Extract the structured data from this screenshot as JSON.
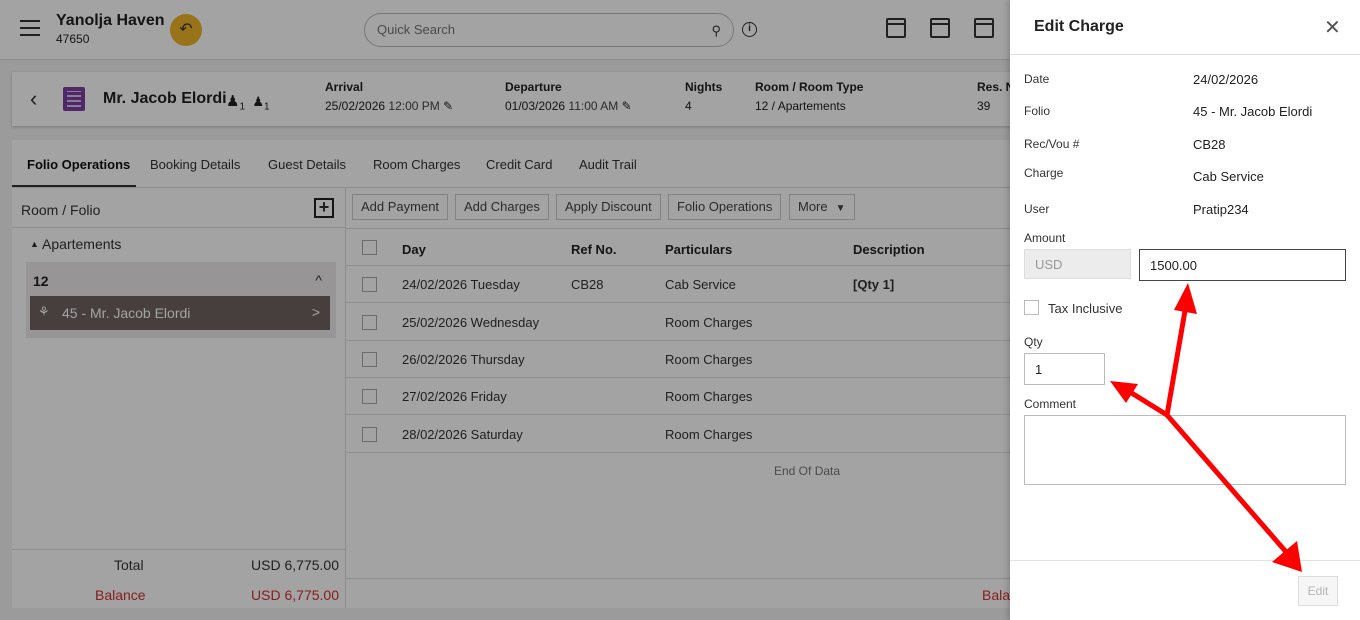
{
  "header": {
    "hotel_name": "Yanolja Haven",
    "hotel_id": "47650",
    "search_placeholder": "Quick Search"
  },
  "guest": {
    "name": "Mr. Jacob Elordi",
    "pax_adults": "1",
    "pax_children": "1",
    "arrival_label": "Arrival",
    "arrival_date": "25/02/2026",
    "arrival_time": "12:00 PM",
    "departure_label": "Departure",
    "departure_date": "01/03/2026",
    "departure_time": "11:00 AM",
    "nights_label": "Nights",
    "nights": "4",
    "room_label": "Room / Room Type",
    "room": "12 / Apartements",
    "res_label": "Res. N",
    "res": "39"
  },
  "tabs": [
    "Folio Operations",
    "Booking Details",
    "Guest Details",
    "Room Charges",
    "Credit Card",
    "Audit Trail"
  ],
  "left_panel": {
    "header": "Room / Folio",
    "group": "Apartements",
    "room_number": "12",
    "folio": "45 - Mr. Jacob Elordi",
    "total_label": "Total",
    "total_value": "USD 6,775.00",
    "balance_label": "Balance",
    "balance_value": "USD 6,775.00"
  },
  "toolbar": {
    "add_payment": "Add Payment",
    "add_charges": "Add Charges",
    "apply_discount": "Apply Discount",
    "folio_operations": "Folio Operations",
    "more": "More"
  },
  "table": {
    "columns": [
      "Day",
      "Ref No.",
      "Particulars",
      "Description"
    ],
    "rows": [
      {
        "day": "24/02/2026 Tuesday",
        "ref": "CB28",
        "particulars": "Cab Service",
        "description": "[Qty 1]"
      },
      {
        "day": "25/02/2026 Wednesday",
        "ref": "",
        "particulars": "Room Charges",
        "description": ""
      },
      {
        "day": "26/02/2026 Thursday",
        "ref": "",
        "particulars": "Room Charges",
        "description": ""
      },
      {
        "day": "27/02/2026 Friday",
        "ref": "",
        "particulars": "Room Charges",
        "description": ""
      },
      {
        "day": "28/02/2026 Saturday",
        "ref": "",
        "particulars": "Room Charges",
        "description": ""
      }
    ],
    "end_of_data": "End Of Data",
    "footer_balance": "Bala"
  },
  "drawer": {
    "title": "Edit Charge",
    "date_label": "Date",
    "date_value": "24/02/2026",
    "folio_label": "Folio",
    "folio_value": "45 - Mr. Jacob Elordi",
    "recvou_label": "Rec/Vou #",
    "recvou_value": "CB28",
    "charge_label": "Charge",
    "charge_value": "Cab Service",
    "user_label": "User",
    "user_value": "Pratip234",
    "amount_label": "Amount",
    "currency": "USD",
    "amount_value": "1500.00",
    "tax_label": "Tax Inclusive",
    "qty_label": "Qty",
    "qty_value": "1",
    "comment_label": "Comment",
    "comment_value": "",
    "edit_button": "Edit"
  },
  "colors": {
    "accent_yellow": "#f0b429",
    "folio_selected": "#6e6362",
    "balance_red": "#d32f2f",
    "annotation_arrow": "#ff0000",
    "building_icon": "#7e3fa6"
  }
}
